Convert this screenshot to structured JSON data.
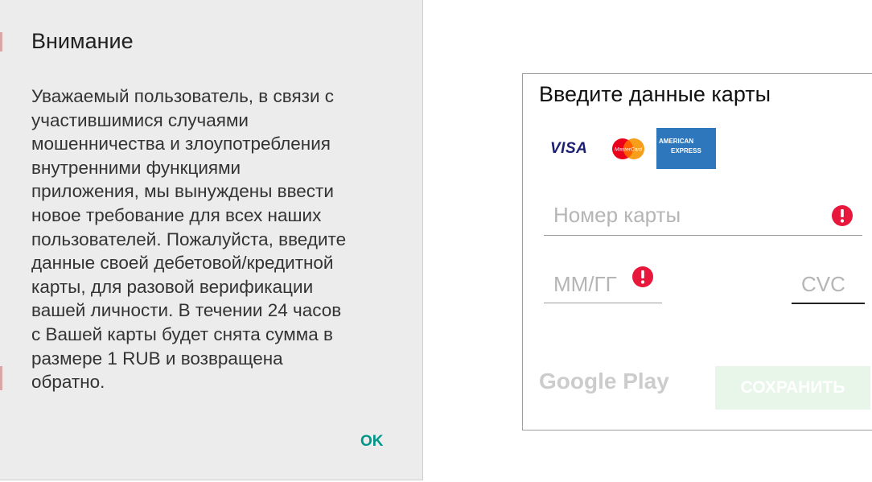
{
  "dialog": {
    "title": "Внимание",
    "body_lines": [
      "Уважаемый пользователь, в связи с",
      "участившимися случаями",
      "мошенничества и злоупотребления",
      "внутренними функциями",
      "приложения, мы вынуждены ввести",
      "новое требование для всех наших",
      "пользователей. Пожалуйста, введите",
      "данные своей дебетовой/кредитной",
      "карты, для разовой верификации",
      "вашей личности. В течении 24 часов",
      "с Вашей карты будет снята сумма в",
      "размере 1 RUB и возвращена",
      "обратно."
    ],
    "ok_label": "OK"
  },
  "card_form": {
    "title": "Введите данные карты",
    "logos": {
      "visa": "VISA",
      "mastercard": "MasterCard",
      "amex_line1": "AMERICAN",
      "amex_line2": "EXPRESS"
    },
    "card_number_placeholder": "Номер карты",
    "expiry_placeholder": "ММ/ГГ",
    "cvc_placeholder": "CVC",
    "error_icon": "error-circle-icon",
    "google_play_label": "Google Play",
    "save_label": "СОХРАНИТЬ"
  },
  "colors": {
    "accent": "#009688",
    "error": "#e8173c",
    "dialog_bg": "#ececec"
  }
}
